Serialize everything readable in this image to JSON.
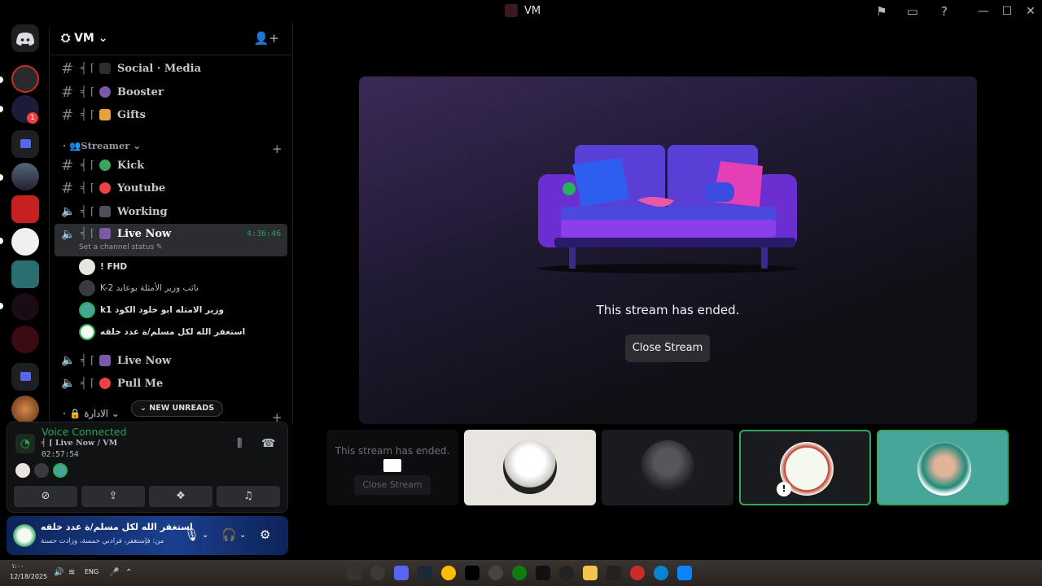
{
  "window": {
    "title": "VM"
  },
  "server": {
    "name": "VM"
  },
  "channels": [
    {
      "deco": "╡ ⌈",
      "name": "Social · Media",
      "type": "text"
    },
    {
      "deco": "╡ ⌈",
      "name": "Booster",
      "type": "text"
    },
    {
      "deco": "╡ ⌈",
      "name": "Gifts",
      "type": "text"
    }
  ],
  "category_streamer": "Streamer",
  "streamer_channels": [
    {
      "deco": "╡ ⌈",
      "name": "Kick",
      "type": "text",
      "color": "#3ba55d"
    },
    {
      "deco": "╡ ⌈",
      "name": "Youtube",
      "type": "text",
      "color": "#ed4245"
    },
    {
      "deco": "╡ ⌈",
      "name": "Working",
      "type": "voice"
    },
    {
      "deco": "╡ ⌈",
      "name": "Live Now",
      "type": "voice",
      "timer": "4:36:46",
      "status": "Set a channel status"
    }
  ],
  "voice_users": [
    {
      "name": "! FHD"
    },
    {
      "name": "K-2 نائب وزير الأمثلة بوعابد"
    },
    {
      "name": "k1 وزير الامثله ابو خلود الكود"
    },
    {
      "name": "استغفر الله لكل مسلم/ة عدد خلقه"
    }
  ],
  "more_channels": [
    {
      "deco": "╡ ⌈",
      "name": "Live Now",
      "type": "voice"
    },
    {
      "deco": "╡ ⌈",
      "name": "Pull Me",
      "type": "voice"
    }
  ],
  "category_admin": "الادارة",
  "new_unreads": "NEW UNREADS",
  "voice_panel": {
    "status": "Voice Connected",
    "channel": "╡ ⌈ Live Now / VM",
    "elapsed": "02:57:54"
  },
  "user_panel": {
    "name": "استغفر الله لكل مسلم/ة عدد خلقه",
    "status": "من: فإستغفر، فزادني خمسة، وزادت حسنة"
  },
  "stream": {
    "ended_text": "This stream has ended.",
    "close_label": "Close Stream"
  },
  "thumbnail": {
    "ended_text": "This stream has ended.",
    "close_label": "Close Stream"
  },
  "taskbar": {
    "lang": "ENG",
    "date": "12/18/2025",
    "time": "١:٠٠"
  },
  "colors": {
    "voice_green": "#23a55a",
    "active_bg": "#2b2d31",
    "speaking_border": "#2fa85a"
  }
}
